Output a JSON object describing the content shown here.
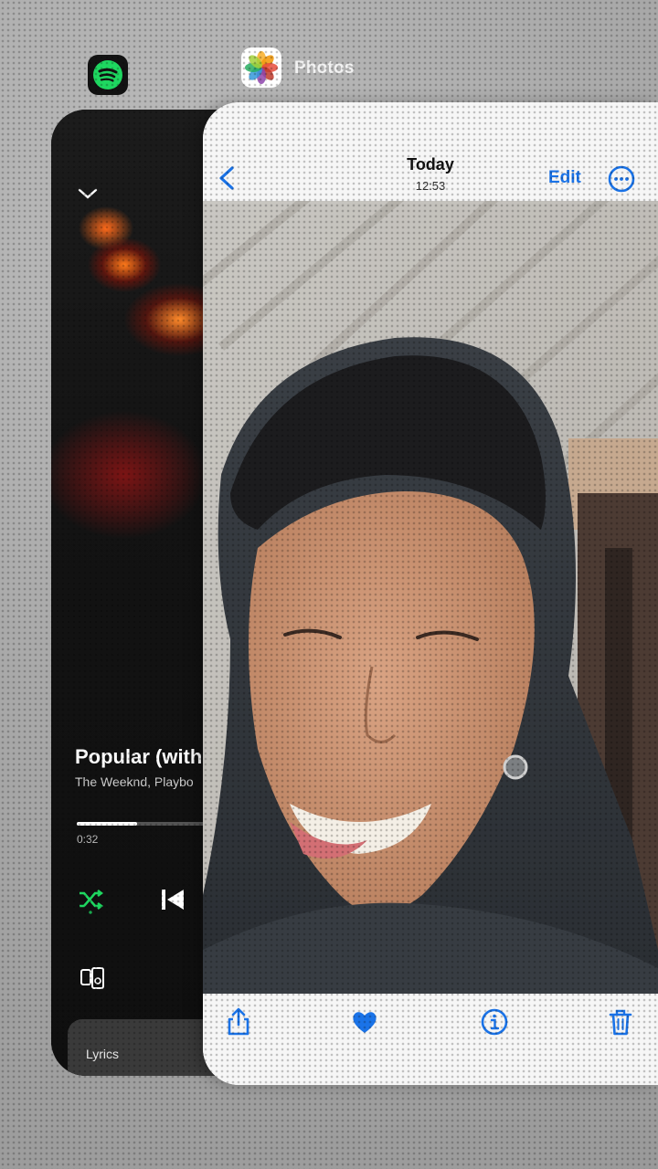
{
  "app_switcher": {
    "spotify_app": {
      "icon": "spotify-icon"
    },
    "photos_app": {
      "icon": "photos-icon",
      "label": "Photos"
    }
  },
  "spotify": {
    "track_title": "Popular (with",
    "track_artist": "The Weeknd, Playbo",
    "progress_time": "0:32",
    "progress_fraction": 0.22,
    "lyrics_label": "Lyrics",
    "accent_color": "#1ed760"
  },
  "photos": {
    "header_title": "Today",
    "header_time": "12:53",
    "edit_label": "Edit",
    "accent_color": "#1a73e8",
    "toolbar": {
      "share_icon": "share-icon",
      "favorite_icon": "heart-icon",
      "info_icon": "info-icon",
      "delete_icon": "trash-icon"
    }
  }
}
